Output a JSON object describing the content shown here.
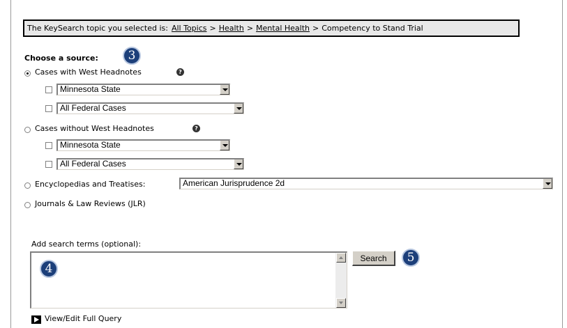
{
  "breadcrumb": {
    "prefix": "The KeySearch topic you selected is:",
    "items": [
      {
        "label": "All Topics",
        "link": true
      },
      {
        "label": "Health",
        "link": true
      },
      {
        "label": "Mental Health",
        "link": true
      },
      {
        "label": "Competency to Stand Trial",
        "link": false
      }
    ],
    "separator": ">"
  },
  "source": {
    "heading": "Choose a source:",
    "options": [
      {
        "label": "Cases with West Headnotes",
        "selected": true,
        "help_icon": "question-circle-icon",
        "subs": [
          {
            "value": "Minnesota State",
            "checked": false
          },
          {
            "value": "All Federal Cases",
            "checked": false
          }
        ]
      },
      {
        "label": "Cases without West Headnotes",
        "selected": false,
        "help_icon": "question-circle-icon",
        "subs": [
          {
            "value": "Minnesota State",
            "checked": false
          },
          {
            "value": "All Federal Cases",
            "checked": false
          }
        ]
      },
      {
        "label": "Encyclopedias and Treatises:",
        "selected": false,
        "select_value": "American Jurisprudence 2d"
      },
      {
        "label": "Journals & Law Reviews (JLR)",
        "selected": false
      }
    ]
  },
  "search": {
    "terms_label": "Add search terms (optional):",
    "terms_value": "",
    "button_label": "Search",
    "full_query_label": "View/Edit Full Query"
  },
  "callouts": [
    "3",
    "4",
    "5"
  ],
  "colors": {
    "callout_fill": "#1c3f7a",
    "breadcrumb_bg": "#e8e8e8"
  },
  "help_glyph": "?"
}
